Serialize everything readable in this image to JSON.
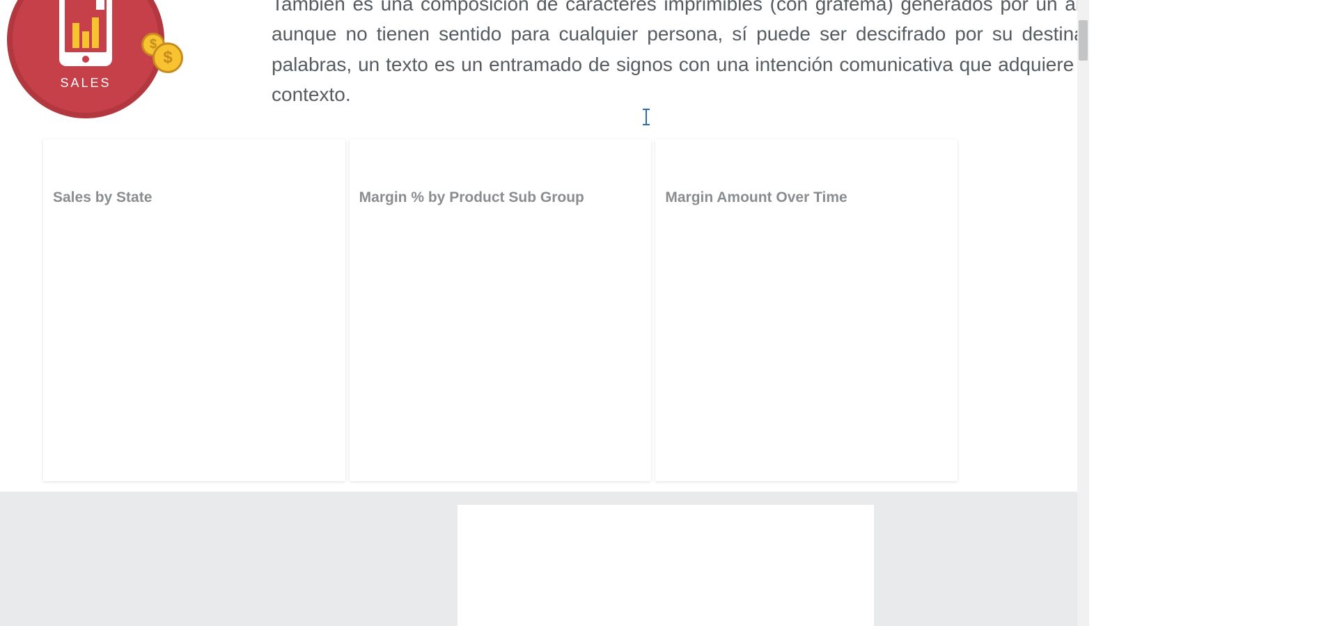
{
  "badge": {
    "label": "SALES"
  },
  "description": {
    "paragraph": "También es una composición de caracteres imprimibles (con grafema) generados por un algoritmo de cifrado que, aunque no tienen sentido para cualquier persona, sí puede ser descifrado por su destinatario original. En otras palabras, un texto es un entramado de signos con una intención comunicativa que adquiere sentido en determinado contexto."
  },
  "panels": [
    {
      "title": "Sales by State"
    },
    {
      "title": "Margin % by Product Sub Group"
    },
    {
      "title": "Margin Amount Over Time"
    }
  ]
}
